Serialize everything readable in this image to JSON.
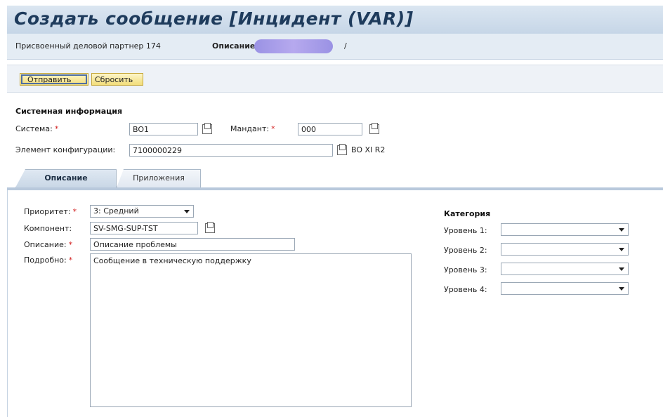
{
  "header": {
    "title": "Создать сообщение [Инцидент (VAR)]"
  },
  "info": {
    "partner_label": "Присвоенный деловой партнер 174",
    "description_label": "Описание",
    "description_suffix": "/"
  },
  "toolbar": {
    "send_label": "Отправить",
    "reset_label": "Сбросить"
  },
  "system_info": {
    "title": "Системная информация",
    "system_label": "Система:",
    "system_value": "BO1",
    "client_label": "Мандант:",
    "client_value": "000",
    "config_label": "Элемент конфигурации:",
    "config_value": "7100000229",
    "config_text": "BO XI R2"
  },
  "tabs": [
    {
      "label": "Описание"
    },
    {
      "label": "Приложения"
    }
  ],
  "form": {
    "priority_label": "Приоритет:",
    "priority_value": "3: Средний",
    "component_label": "Компонент:",
    "component_value": "SV-SMG-SUP-TST",
    "description_label": "Описание:",
    "description_value": "Описание проблемы",
    "details_label": "Подробно:",
    "details_value": "Сообщение в техническую поддержку"
  },
  "category": {
    "title": "Категория",
    "levels": [
      {
        "label": "Уровень 1:",
        "value": ""
      },
      {
        "label": "Уровень 2:",
        "value": ""
      },
      {
        "label": "Уровень 3:",
        "value": ""
      },
      {
        "label": "Уровень 4:",
        "value": ""
      }
    ]
  },
  "colors": {
    "required": "#d21f1f",
    "button": "#f2dd7a",
    "title": "#1e3b5c"
  },
  "icons": {
    "f4_help": "value-help-icon",
    "dropdown": "chevron-down-icon"
  }
}
